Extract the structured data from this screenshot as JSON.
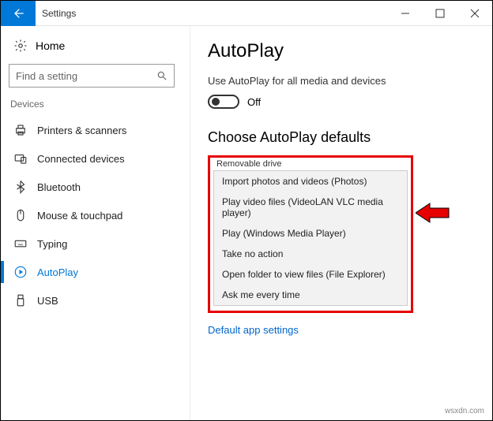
{
  "window": {
    "title": "Settings"
  },
  "sidebar": {
    "home": "Home",
    "search_placeholder": "Find a setting",
    "section": "Devices",
    "items": [
      {
        "label": "Printers & scanners"
      },
      {
        "label": "Connected devices"
      },
      {
        "label": "Bluetooth"
      },
      {
        "label": "Mouse & touchpad"
      },
      {
        "label": "Typing"
      },
      {
        "label": "AutoPlay"
      },
      {
        "label": "USB"
      }
    ]
  },
  "main": {
    "title": "AutoPlay",
    "toggle_caption": "Use AutoPlay for all media and devices",
    "toggle_state": "Off",
    "defaults_heading": "Choose AutoPlay defaults",
    "dropdown_label": "Removable drive",
    "options": [
      "Import photos and videos (Photos)",
      "Play video files (VideoLAN VLC media player)",
      "Play (Windows Media Player)",
      "Take no action",
      "Open folder to view files (File Explorer)",
      "Ask me every time"
    ],
    "related_link": "Default app settings"
  },
  "watermark": "wsxdn.com"
}
